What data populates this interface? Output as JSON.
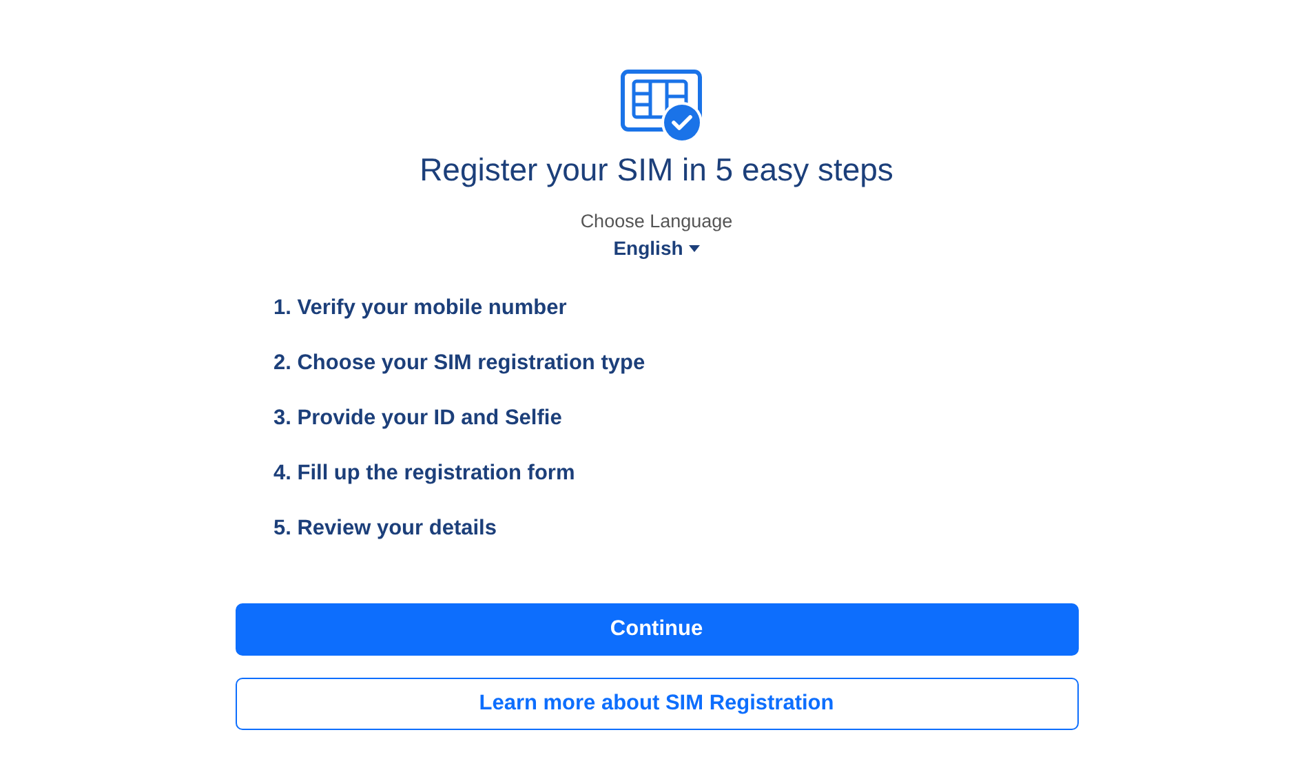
{
  "title": "Register your SIM in 5 easy steps",
  "language": {
    "label": "Choose Language",
    "value": "English"
  },
  "steps": [
    "1. Verify your mobile number",
    "2. Choose your SIM registration type",
    "3. Provide your ID and Selfie",
    "4. Fill up the registration form",
    "5. Review your details"
  ],
  "buttons": [
    {
      "label": "Continue",
      "kind": "primary"
    },
    {
      "label": "Learn more about SIM Registration",
      "kind": "outline"
    }
  ]
}
